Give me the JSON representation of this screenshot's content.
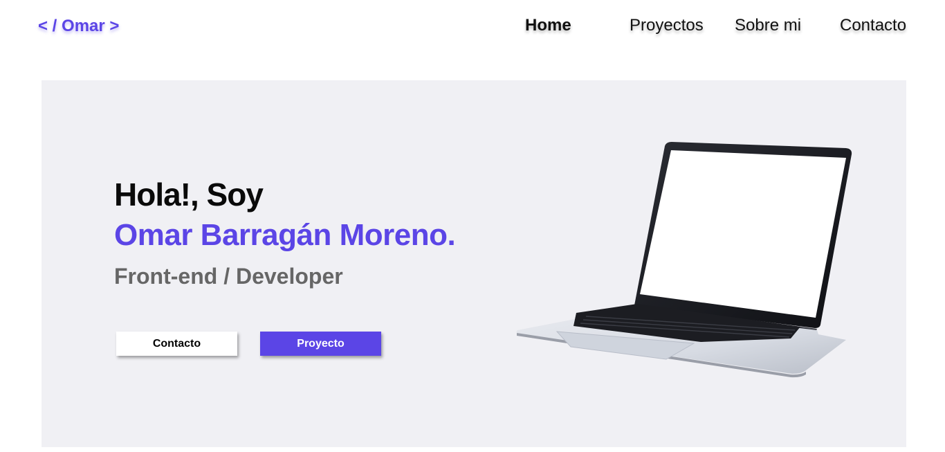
{
  "nav": {
    "logo": "< / Omar >",
    "links": [
      "Home",
      "Proyectos",
      "Sobre mi",
      "Contacto"
    ],
    "active": "Home"
  },
  "hero": {
    "greeting": "Hola!, Soy",
    "name": "Omar Barragán Moreno.",
    "role": "Front-end / Developer",
    "buttons": {
      "contacto": "Contacto",
      "proyecto": "Proyecto"
    },
    "image": "laptop"
  },
  "colors": {
    "accent": "#5b45e6",
    "hero_bg": "#f0f0f4",
    "role_text": "#666666"
  }
}
